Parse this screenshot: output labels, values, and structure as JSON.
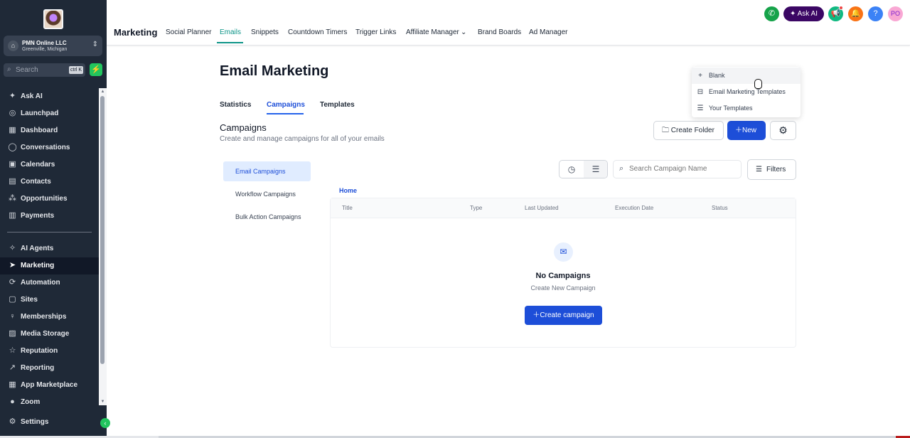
{
  "sidebar": {
    "location": {
      "name": "PMN Online LLC",
      "sub": "Greenville, Michigan"
    },
    "search": {
      "placeholder": "Search",
      "shortcut": "ctrl K"
    },
    "items": [
      {
        "label": "Ask AI",
        "icon": "sparkle-icon",
        "glyph": "✦"
      },
      {
        "label": "Launchpad",
        "icon": "launchpad-icon",
        "glyph": "◎"
      },
      {
        "label": "Dashboard",
        "icon": "dashboard-icon",
        "glyph": "▦"
      },
      {
        "label": "Conversations",
        "icon": "chat-icon",
        "glyph": "◯"
      },
      {
        "label": "Calendars",
        "icon": "calendar-icon",
        "glyph": "▣"
      },
      {
        "label": "Contacts",
        "icon": "contacts-icon",
        "glyph": "▤"
      },
      {
        "label": "Opportunities",
        "icon": "opportunities-icon",
        "glyph": "⁂"
      },
      {
        "label": "Payments",
        "icon": "payments-icon",
        "glyph": "▥"
      },
      {
        "label": "AI Agents",
        "icon": "ai-agents-icon",
        "glyph": "✧"
      },
      {
        "label": "Marketing",
        "icon": "send-icon",
        "glyph": "➤"
      },
      {
        "label": "Automation",
        "icon": "automation-icon",
        "glyph": "⟳"
      },
      {
        "label": "Sites",
        "icon": "sites-icon",
        "glyph": "▢"
      },
      {
        "label": "Memberships",
        "icon": "memberships-icon",
        "glyph": "♀"
      },
      {
        "label": "Media Storage",
        "icon": "media-icon",
        "glyph": "▨"
      },
      {
        "label": "Reputation",
        "icon": "star-icon",
        "glyph": "☆"
      },
      {
        "label": "Reporting",
        "icon": "reporting-icon",
        "glyph": "↗"
      },
      {
        "label": "App Marketplace",
        "icon": "marketplace-icon",
        "glyph": "▦"
      },
      {
        "label": "Zoom",
        "icon": "zoom-icon",
        "glyph": "●"
      },
      {
        "label": "Settings",
        "icon": "gear-icon",
        "glyph": "⚙"
      }
    ],
    "active": "Marketing"
  },
  "header": {
    "section": "Marketing",
    "tabs": [
      "Social Planner",
      "Emails",
      "Snippets",
      "Countdown Timers",
      "Trigger Links",
      "Affiliate Manager",
      "Brand Boards",
      "Ad Manager"
    ],
    "active_tab": "Emails",
    "ask_ai": "Ask AI",
    "avatar_initials": "PO"
  },
  "main": {
    "title": "Email Marketing",
    "subtabs": [
      "Statistics",
      "Campaigns",
      "Templates"
    ],
    "active_subtab": "Campaigns",
    "campaigns_title": "Campaigns",
    "campaigns_desc": "Create and manage campaigns for all of your emails",
    "create_folder": "Create Folder",
    "new_button": "New",
    "left_list": [
      "Email Campaigns",
      "Workflow Campaigns",
      "Bulk Action Campaigns"
    ],
    "search_placeholder": "Search Campaign Name",
    "filters": "Filters",
    "breadcrumb": "Home",
    "columns": [
      "Title",
      "Type",
      "Last Updated",
      "Execution Date",
      "Status"
    ],
    "empty_title": "No Campaigns",
    "empty_sub": "Create New Campaign",
    "create_campaign": "Create campaign"
  },
  "dropdown": {
    "items": [
      {
        "label": "Blank",
        "icon": "plus-icon"
      },
      {
        "label": "Email Marketing Templates",
        "icon": "inbox-icon"
      },
      {
        "label": "Your Templates",
        "icon": "database-icon"
      }
    ]
  },
  "colors": {
    "sidebar": "#1f2937",
    "primary": "#1d4ed8",
    "accent_teal": "#0d9488",
    "ask_ai": "#3b0764"
  }
}
